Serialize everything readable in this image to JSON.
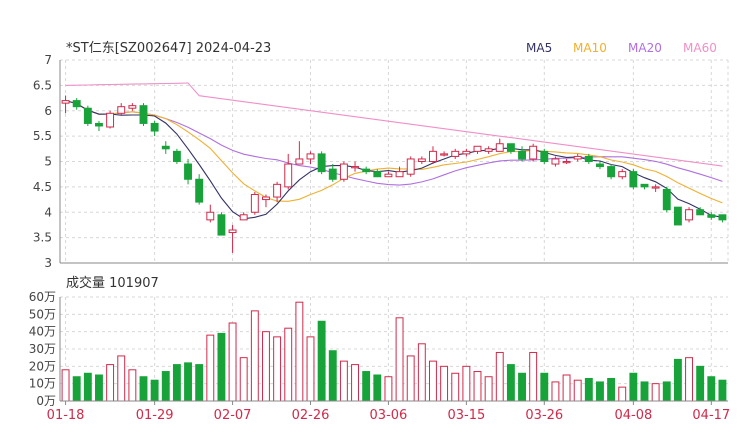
{
  "chart_data": {
    "type": "candlestick",
    "title": "*ST仁东[SZ002647] 2024-04-23",
    "legend": [
      {
        "name": "MA5",
        "color": "#333366"
      },
      {
        "name": "MA10",
        "color": "#f0b030"
      },
      {
        "name": "MA20",
        "color": "#b070e0"
      },
      {
        "name": "MA60",
        "color": "#f090c8"
      }
    ],
    "colors": {
      "up": "#d12a4a",
      "down": "#18a33a",
      "grid": "#d8d8d8",
      "axis": "#444444",
      "date_label": "#d12a4a"
    },
    "price_axis": {
      "ylim": [
        3,
        7
      ],
      "ticks": [
        "7",
        "6.5",
        "6",
        "5.5",
        "5",
        "4.5",
        "4",
        "3.5",
        "3"
      ]
    },
    "volume_label": "成交量 101907",
    "volume_axis": {
      "ylim": [
        0,
        60
      ],
      "ticks": [
        "60万",
        "50万",
        "40万",
        "30万",
        "20万",
        "10万",
        "0万"
      ]
    },
    "dates": [
      "01-18",
      "01-29",
      "02-07",
      "02-26",
      "03-06",
      "03-15",
      "03-26",
      "04-08",
      "04-17"
    ],
    "candles": [
      [
        6.15,
        6.2,
        6.3,
        5.95
      ],
      [
        6.2,
        6.08,
        6.25,
        6.02
      ],
      [
        6.05,
        5.75,
        6.1,
        5.7
      ],
      [
        5.75,
        5.7,
        5.8,
        5.6
      ],
      [
        5.68,
        5.95,
        6.0,
        5.65
      ],
      [
        5.95,
        6.08,
        6.15,
        5.9
      ],
      [
        6.05,
        6.1,
        6.15,
        6.0
      ],
      [
        6.1,
        5.75,
        6.15,
        5.7
      ],
      [
        5.75,
        5.6,
        5.8,
        5.5
      ],
      [
        5.3,
        5.25,
        5.4,
        5.15
      ],
      [
        5.2,
        5.0,
        5.25,
        4.95
      ],
      [
        4.95,
        4.65,
        5.05,
        4.55
      ],
      [
        4.65,
        4.2,
        4.75,
        4.15
      ],
      [
        3.85,
        4.0,
        4.15,
        3.8
      ],
      [
        3.95,
        3.55,
        4.0,
        3.55
      ],
      [
        3.6,
        3.65,
        3.75,
        3.2
      ],
      [
        3.85,
        3.95,
        4.0,
        3.85
      ],
      [
        4.0,
        4.35,
        4.4,
        3.95
      ],
      [
        4.25,
        4.3,
        4.35,
        4.1
      ],
      [
        4.3,
        4.55,
        4.6,
        4.2
      ],
      [
        4.5,
        4.95,
        5.15,
        4.45
      ],
      [
        4.95,
        5.05,
        5.4,
        4.95
      ],
      [
        5.05,
        5.15,
        5.2,
        4.95
      ],
      [
        5.15,
        4.8,
        5.2,
        4.75
      ],
      [
        4.85,
        4.65,
        4.95,
        4.6
      ],
      [
        4.65,
        4.95,
        5.0,
        4.6
      ],
      [
        4.9,
        4.9,
        5.0,
        4.8
      ],
      [
        4.85,
        4.8,
        4.9,
        4.75
      ],
      [
        4.8,
        4.7,
        4.85,
        4.7
      ],
      [
        4.7,
        4.75,
        4.8,
        4.7
      ],
      [
        4.7,
        4.8,
        4.9,
        4.7
      ],
      [
        4.75,
        5.05,
        5.1,
        4.7
      ],
      [
        5.0,
        5.05,
        5.1,
        4.95
      ],
      [
        5.0,
        5.2,
        5.3,
        4.95
      ],
      [
        5.15,
        5.15,
        5.2,
        5.1
      ],
      [
        5.1,
        5.2,
        5.25,
        5.05
      ],
      [
        5.15,
        5.2,
        5.25,
        5.1
      ],
      [
        5.2,
        5.3,
        5.3,
        5.15
      ],
      [
        5.2,
        5.25,
        5.3,
        5.15
      ],
      [
        5.2,
        5.35,
        5.45,
        5.2
      ],
      [
        5.35,
        5.2,
        5.35,
        5.15
      ],
      [
        5.2,
        5.05,
        5.3,
        5.0
      ],
      [
        5.05,
        5.3,
        5.35,
        5.0
      ],
      [
        5.2,
        5.0,
        5.25,
        4.95
      ],
      [
        4.95,
        5.05,
        5.1,
        4.9
      ],
      [
        5.0,
        5.0,
        5.05,
        4.95
      ],
      [
        5.05,
        5.1,
        5.15,
        5.0
      ],
      [
        5.1,
        5.0,
        5.15,
        4.95
      ],
      [
        4.95,
        4.9,
        5.0,
        4.85
      ],
      [
        4.9,
        4.7,
        4.95,
        4.65
      ],
      [
        4.7,
        4.8,
        4.85,
        4.65
      ],
      [
        4.8,
        4.5,
        4.85,
        4.45
      ],
      [
        4.55,
        4.5,
        4.55,
        4.45
      ],
      [
        4.5,
        4.5,
        4.55,
        4.4
      ],
      [
        4.45,
        4.05,
        4.5,
        4.0
      ],
      [
        4.1,
        3.75,
        4.1,
        3.75
      ],
      [
        3.85,
        4.05,
        4.1,
        3.8
      ],
      [
        4.05,
        3.95,
        4.1,
        3.95
      ],
      [
        3.95,
        3.9,
        4.0,
        3.85
      ],
      [
        3.95,
        3.85,
        3.95,
        3.8
      ]
    ],
    "volumes": [
      18,
      14,
      16,
      15,
      21,
      26,
      18,
      14,
      12,
      17,
      21,
      22,
      21,
      38,
      39,
      45,
      25,
      52,
      40,
      37,
      42,
      57,
      37,
      46,
      29,
      23,
      21,
      17,
      15,
      14,
      48,
      26,
      33,
      23,
      20,
      16,
      20,
      17,
      14,
      28,
      21,
      16,
      28,
      16,
      11,
      15,
      12,
      13,
      11,
      13,
      8,
      16,
      11,
      10,
      11,
      24,
      25,
      20,
      14,
      12,
      11
    ]
  }
}
